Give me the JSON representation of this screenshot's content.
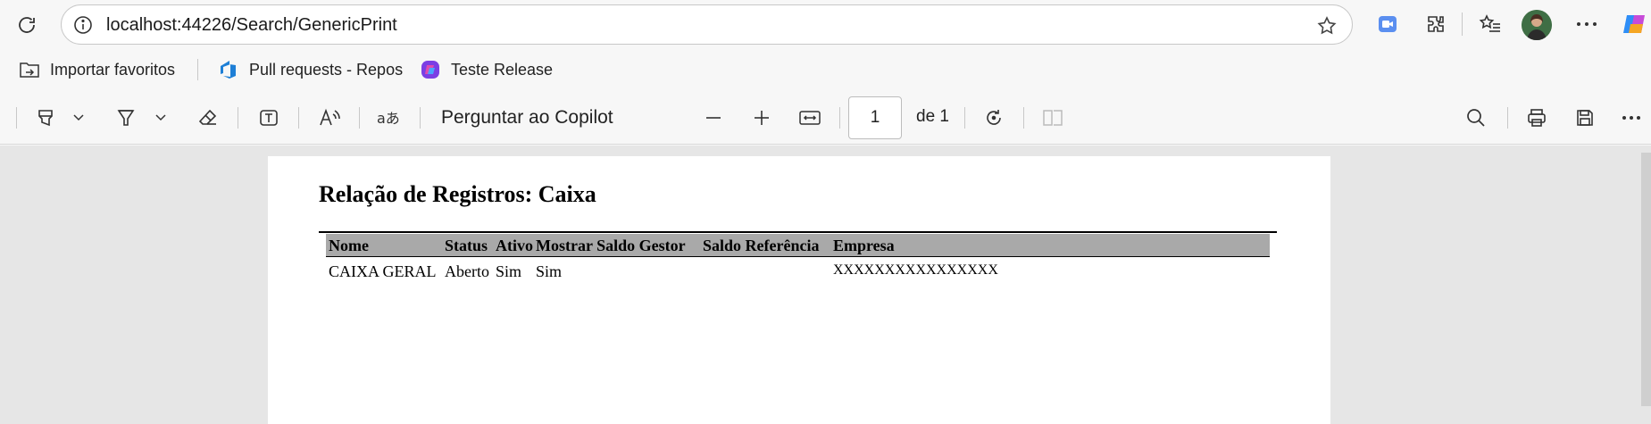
{
  "browser": {
    "url": "localhost:44226/Search/GenericPrint",
    "favorites": [
      {
        "label": "Importar favoritos",
        "icon": "import-favorites-icon"
      },
      {
        "label": "Pull requests - Repos",
        "icon": "azure-devops-icon"
      },
      {
        "label": "Teste Release",
        "icon": "copilot-app-icon"
      }
    ]
  },
  "pdf_toolbar": {
    "copilot_label": "Perguntar ao Copilot",
    "current_page": "1",
    "page_of": "de 1"
  },
  "document": {
    "title": "Relação de Registros: Caixa",
    "columns": [
      "Nome",
      "Status",
      "Ativo",
      "Mostrar Saldo Gestor",
      "Saldo Referência",
      "Empresa"
    ],
    "rows": [
      [
        "CAIXA GERAL",
        "Aberto",
        "Sim",
        "Sim",
        "",
        "XXXXXXXXXXXXXXXX"
      ]
    ]
  }
}
